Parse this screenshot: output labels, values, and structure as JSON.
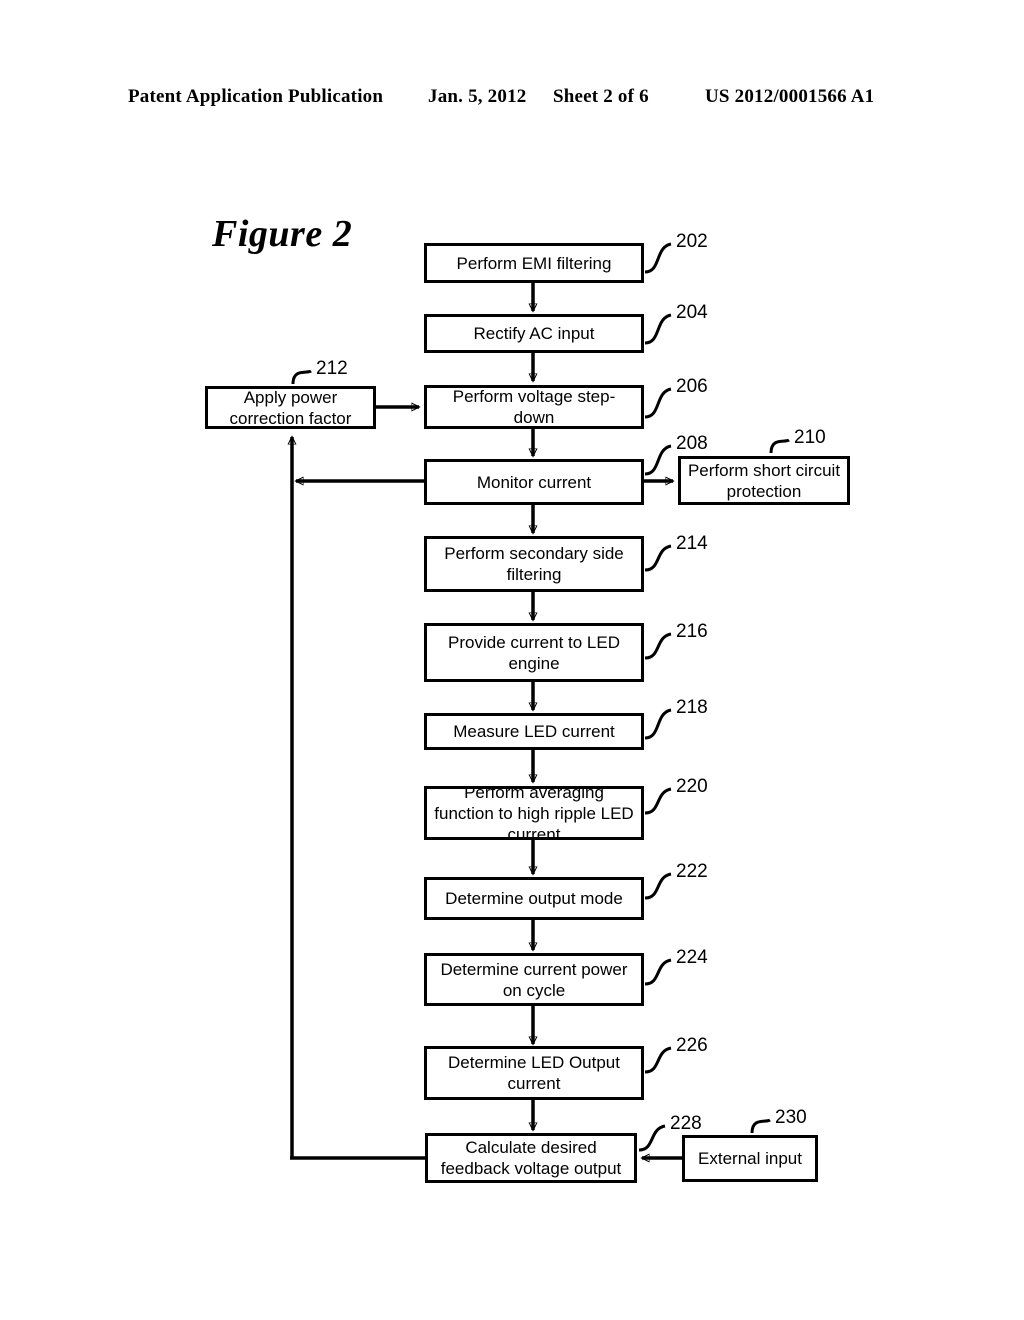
{
  "header": {
    "publication": "Patent Application Publication",
    "date": "Jan. 5, 2012",
    "sheet": "Sheet 2 of 6",
    "number": "US 2012/0001566 A1"
  },
  "figure": {
    "title": "Figure 2"
  },
  "diagram": {
    "type": "flowchart",
    "nodes": [
      {
        "ref": "202",
        "label": "Perform EMI filtering"
      },
      {
        "ref": "204",
        "label": "Rectify AC input"
      },
      {
        "ref": "206",
        "label": "Perform voltage step-down"
      },
      {
        "ref": "208",
        "label": "Monitor current"
      },
      {
        "ref": "210",
        "label": "Perform short circuit protection"
      },
      {
        "ref": "212",
        "label": "Apply power correction factor"
      },
      {
        "ref": "214",
        "label": "Perform secondary side filtering"
      },
      {
        "ref": "216",
        "label": "Provide current to LED engine"
      },
      {
        "ref": "218",
        "label": "Measure LED current"
      },
      {
        "ref": "220",
        "label": "Perform averaging function to high ripple LED current"
      },
      {
        "ref": "222",
        "label": "Determine output mode"
      },
      {
        "ref": "224",
        "label": "Determine current power on cycle"
      },
      {
        "ref": "226",
        "label": "Determine LED Output current"
      },
      {
        "ref": "228",
        "label": "Calculate desired feedback voltage output"
      },
      {
        "ref": "230",
        "label": "External input"
      }
    ],
    "edges": [
      {
        "from": "202",
        "to": "204"
      },
      {
        "from": "204",
        "to": "206"
      },
      {
        "from": "212",
        "to": "206"
      },
      {
        "from": "206",
        "to": "208"
      },
      {
        "from": "208",
        "to": "210"
      },
      {
        "from": "208",
        "to": "212"
      },
      {
        "from": "208",
        "to": "214"
      },
      {
        "from": "214",
        "to": "216"
      },
      {
        "from": "216",
        "to": "218"
      },
      {
        "from": "218",
        "to": "220"
      },
      {
        "from": "220",
        "to": "222"
      },
      {
        "from": "222",
        "to": "224"
      },
      {
        "from": "224",
        "to": "226"
      },
      {
        "from": "226",
        "to": "228"
      },
      {
        "from": "230",
        "to": "228"
      },
      {
        "from": "228",
        "to": "212"
      }
    ]
  },
  "colors": {
    "ink": "#000000",
    "paper": "#ffffff"
  }
}
